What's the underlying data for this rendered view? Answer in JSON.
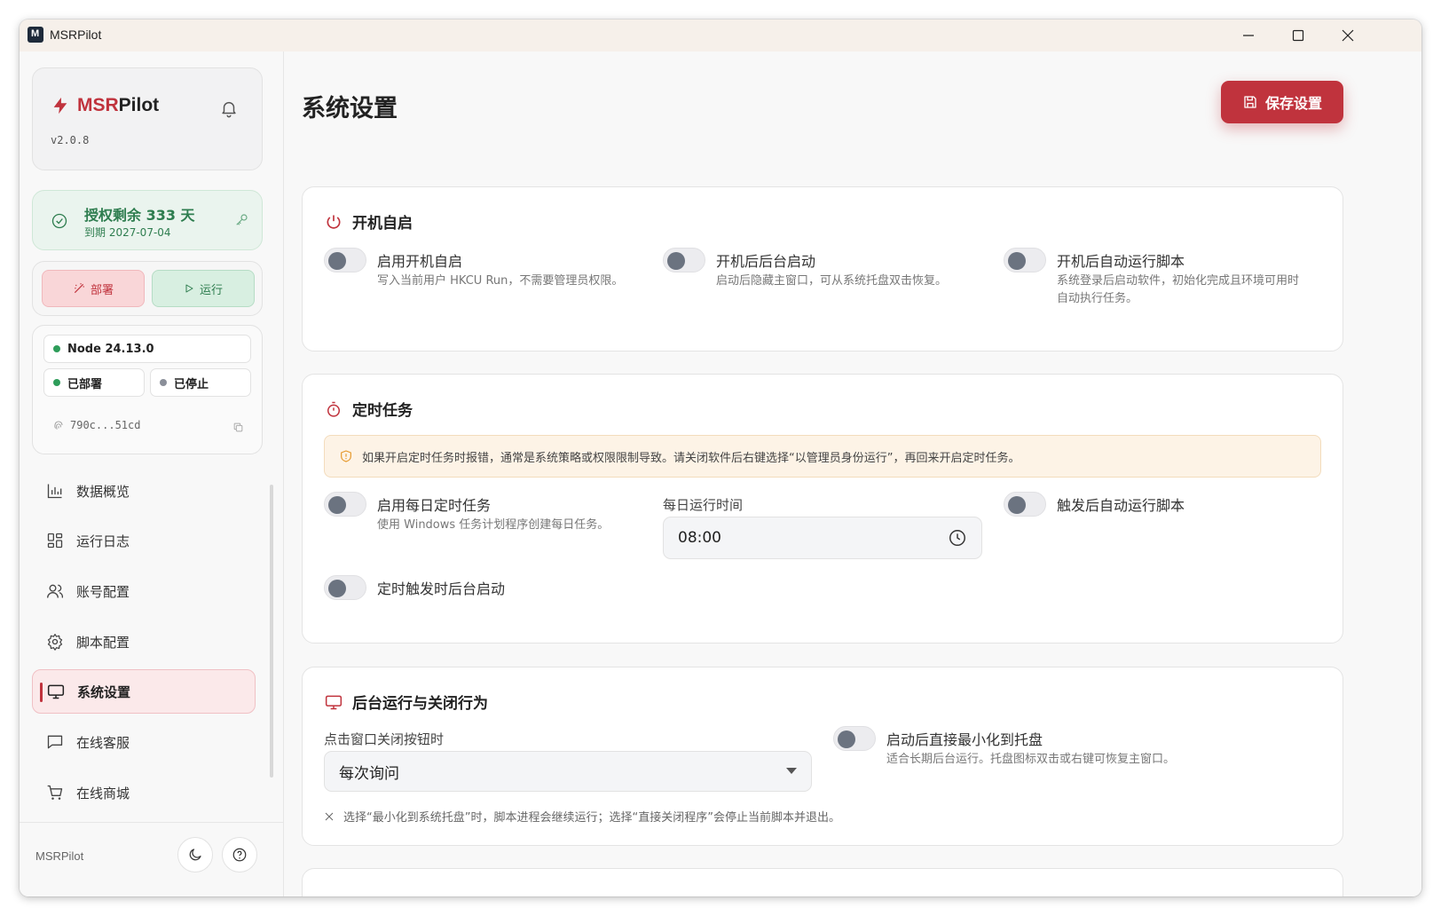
{
  "window": {
    "title": "MSRPilot",
    "app_icon_letter": "M"
  },
  "sidebar": {
    "brand_prefix": "MSR",
    "brand_suffix": "Pilot",
    "version": "v2.0.8",
    "license_title": "授权剩余 333 天",
    "license_expiry": "到期 2027-07-04",
    "deploy_label": "部署",
    "run_label": "运行",
    "node_version": "Node 24.13.0",
    "deployed_status": "已部署",
    "stopped_status": "已停止",
    "machine_hash": "790c...51cd",
    "items": [
      {
        "label": "数据概览",
        "icon": "bar-chart-icon"
      },
      {
        "label": "运行日志",
        "icon": "grid-icon"
      },
      {
        "label": "账号配置",
        "icon": "users-icon"
      },
      {
        "label": "脚本配置",
        "icon": "gear-icon"
      },
      {
        "label": "系统设置",
        "icon": "monitor-icon",
        "active": true
      },
      {
        "label": "在线客服",
        "icon": "chat-icon"
      },
      {
        "label": "在线商城",
        "icon": "cart-icon"
      }
    ],
    "footer_label": "MSRPilot"
  },
  "main": {
    "title": "系统设置",
    "save_label": "保存设置",
    "startup": {
      "title": "开机自启",
      "options": [
        {
          "label": "启用开机自启",
          "desc": "写入当前用户 HKCU Run，不需要管理员权限。"
        },
        {
          "label": "开机后后台启动",
          "desc": "启动后隐藏主窗口，可从系统托盘双击恢复。"
        },
        {
          "label": "开机后自动运行脚本",
          "desc_line1": "系统登录后启动软件，初始化完成且环境可用时",
          "desc_line2": "自动执行任务。"
        }
      ]
    },
    "schedule": {
      "title": "定时任务",
      "alert": "如果开启定时任务时报错，通常是系统策略或权限限制导致。请关闭软件后右键选择“以管理员身份运行”，再回来开启定时任务。",
      "daily_label": "启用每日定时任务",
      "daily_desc": "使用 Windows 任务计划程序创建每日任务。",
      "time_label": "每日运行时间",
      "time_value": "08:00",
      "auto_run_label": "触发后自动运行脚本",
      "background_label": "定时触发时后台启动"
    },
    "background": {
      "title": "后台运行与关闭行为",
      "close_label": "点击窗口关闭按钮时",
      "close_value": "每次询问",
      "minimize_label": "启动后直接最小化到托盘",
      "minimize_desc": "适合长期后台运行。托盘图标双击或右键可恢复主窗口。",
      "note": "选择“最小化到系统托盘”时，脚本进程会继续运行；选择“直接关闭程序”会停止当前脚本并退出。"
    }
  },
  "colors": {
    "accent": "#c0333d",
    "success": "#2e7d4f",
    "warning_bg": "#fdf3e6"
  }
}
